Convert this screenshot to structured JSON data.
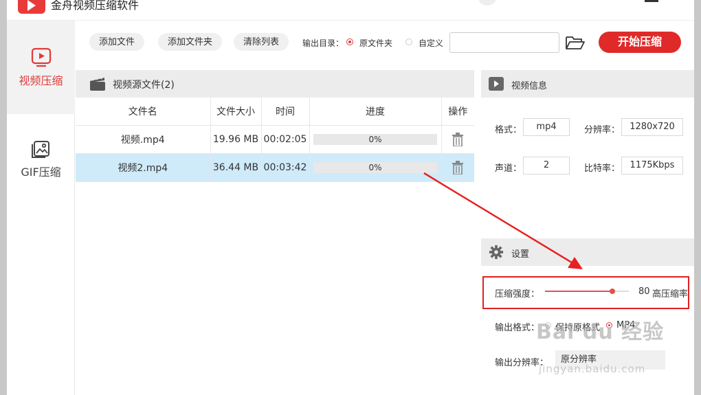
{
  "app": {
    "title": "金舟视频压缩软件"
  },
  "sidebar": {
    "items": [
      {
        "label": "视频压缩",
        "icon": "video-play-icon",
        "active": true
      },
      {
        "label": "GIF压缩",
        "icon": "image-stack-icon",
        "active": false
      }
    ]
  },
  "toolbar": {
    "add_file": "添加文件",
    "add_folder": "添加文件夹",
    "clear_list": "清除列表",
    "output_dir_label": "输出目录：",
    "option_source": "原文件夹",
    "option_custom": "自定义",
    "output_path": "",
    "start": "开始压缩"
  },
  "file_panel": {
    "title": "视频源文件(2)",
    "columns": [
      "文件名",
      "文件大小",
      "时间",
      "进度",
      "操作"
    ],
    "rows": [
      {
        "name": "视频.mp4",
        "size": "19.96 MB",
        "time": "00:02:05",
        "progress": "0%",
        "progress_value": 0,
        "selected": false
      },
      {
        "name": "视频2.mp4",
        "size": "36.44 MB",
        "time": "00:03:42",
        "progress": "0%",
        "progress_value": 0,
        "selected": true
      }
    ]
  },
  "video_info": {
    "title": "视频信息",
    "format_label": "格式：",
    "format": "mp4",
    "resolution_label": "分辨率：",
    "resolution": "1280x720",
    "channels_label": "声道：",
    "channels": "2",
    "bitrate_label": "比特率：",
    "bitrate": "1175Kbps"
  },
  "settings": {
    "title": "设置",
    "strength_label": "压缩强度：",
    "strength_value": 80,
    "strength_display": "80",
    "strength_desc": "高压缩率",
    "output_format_label": "输出格式：",
    "format_keep": "保持原格式",
    "format_mp4": "MP4",
    "output_resolution_label": "输出分辨率：",
    "output_resolution": "原分辨率"
  },
  "watermark": {
    "text": "Bai du 经验",
    "sub": "jingyan.baidu.com"
  },
  "colors": {
    "accent": "#e02a2a",
    "selected_row": "#cfeaf9",
    "header_bg": "#ececec"
  }
}
